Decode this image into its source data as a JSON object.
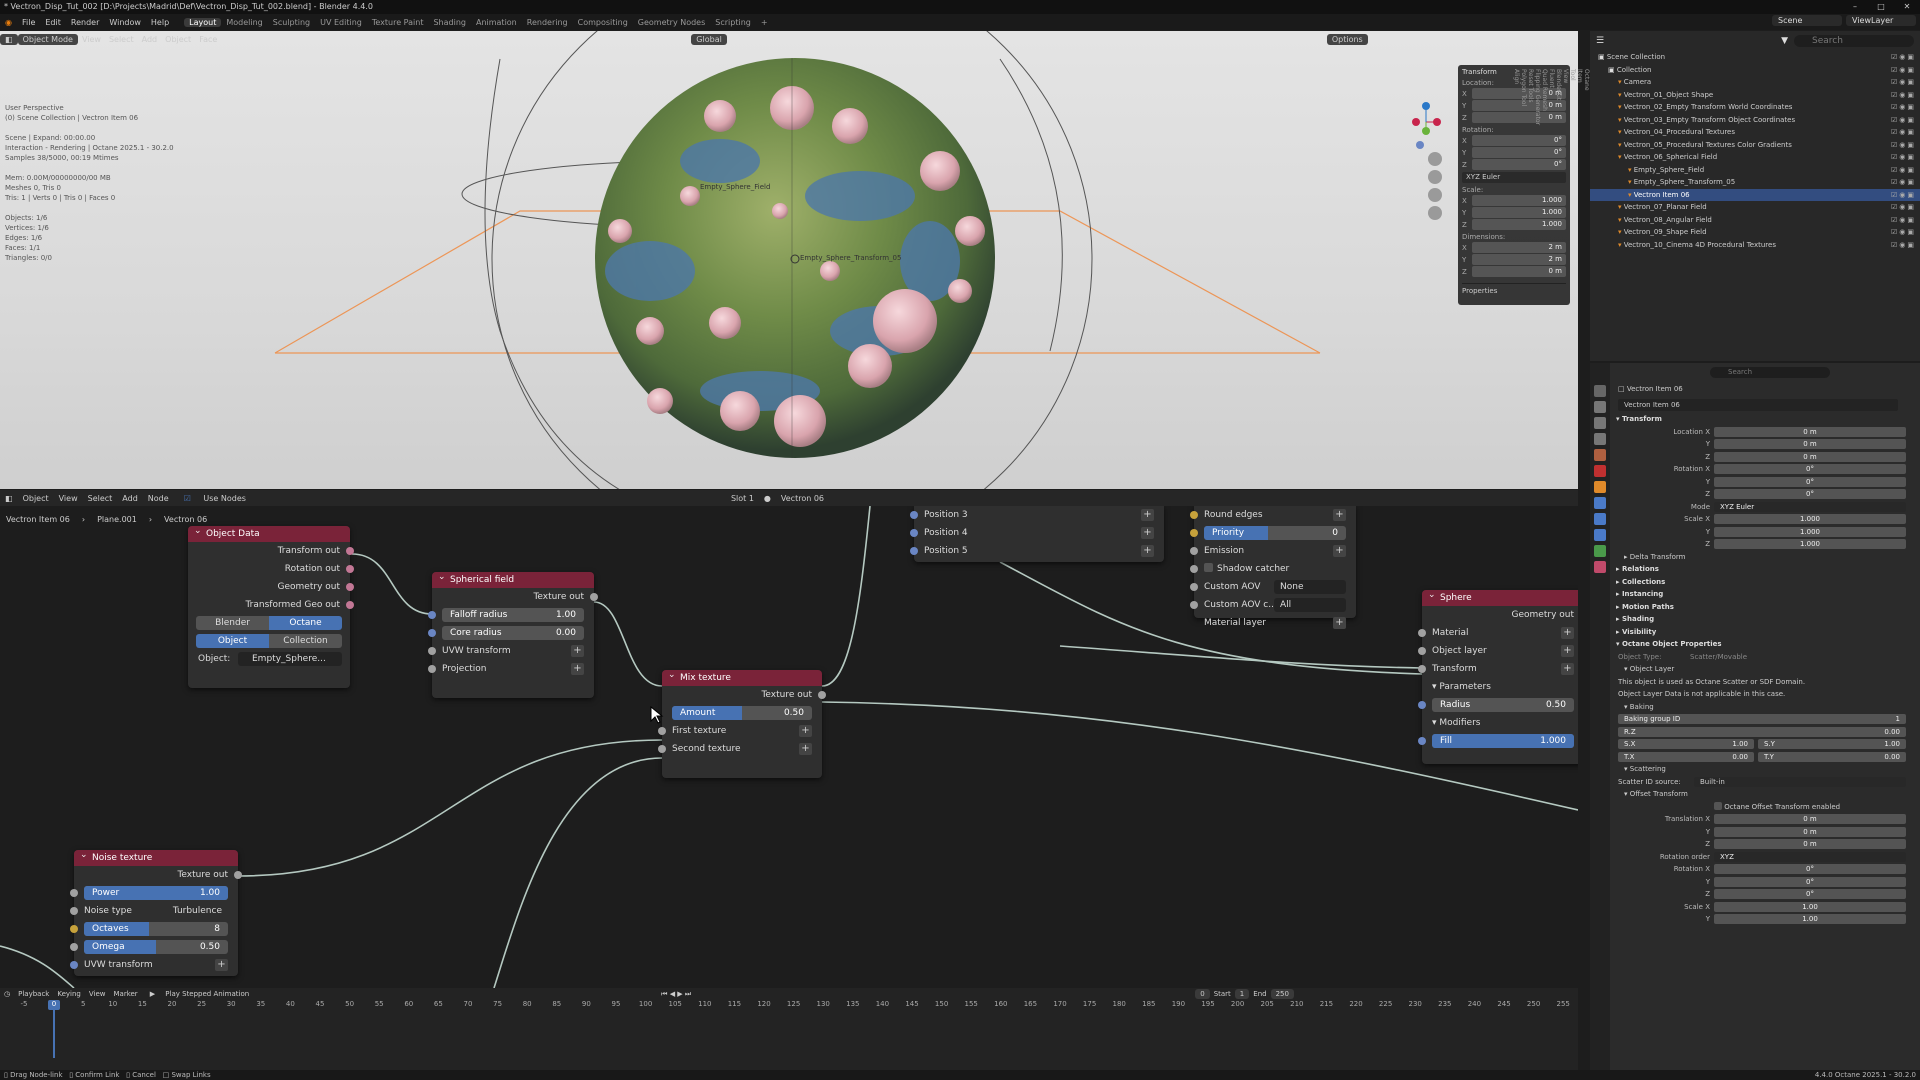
{
  "window": {
    "title": "* Vectron_Disp_Tut_002 [D:\\Projects\\Madrid\\Def\\Vectron_Disp_Tut_002.blend] - Blender 4.4.0"
  },
  "menubar": {
    "menus": [
      "File",
      "Edit",
      "Render",
      "Window",
      "Help"
    ],
    "workspaces": [
      "Layout",
      "Modeling",
      "Sculpting",
      "UV Editing",
      "Texture Paint",
      "Shading",
      "Animation",
      "Rendering",
      "Compositing",
      "Geometry Nodes",
      "Scripting"
    ],
    "active_workspace": "Layout",
    "scene": "Scene",
    "view_layer": "ViewLayer"
  },
  "viewport": {
    "mode": "Object Mode",
    "menus": [
      "View",
      "Select",
      "Add",
      "Object",
      "Face"
    ],
    "orientation": "Global",
    "options": "Options",
    "info": "User Perspective\n(0) Scene Collection | Vectron Item 06\n\nScene | Expand: 00:00.00\nInteraction - Rendering | Octane 2025.1 - 30.2.0\nSamples 38/5000, 00:19 Mtimes\n\nMem: 0.00M/00000000/00 MB\nMeshes 0, Tris 0\nTris: 1 | Verts 0 | Tris 0 | Faces 0\n\nObjects: 1/6\nVertices: 1/6\nEdges: 1/6\nFaces: 1/1\nTriangles: 0/0",
    "labels": {
      "field": "Empty_Sphere_Field",
      "transform": "Empty_Sphere_Transform_05"
    }
  },
  "n_panel": {
    "title": "Transform",
    "location_label": "Location:",
    "location": [
      {
        "axis": "X",
        "value": "0 m"
      },
      {
        "axis": "Y",
        "value": "0 m"
      },
      {
        "axis": "Z",
        "value": "0 m"
      }
    ],
    "rotation_label": "Rotation:",
    "rotation": [
      {
        "axis": "X",
        "value": "0°"
      },
      {
        "axis": "Y",
        "value": "0°"
      },
      {
        "axis": "Z",
        "value": "0°"
      }
    ],
    "rotation_mode": "XYZ Euler",
    "scale_label": "Scale:",
    "scale": [
      {
        "axis": "X",
        "value": "1.000"
      },
      {
        "axis": "Y",
        "value": "1.000"
      },
      {
        "axis": "Z",
        "value": "1.000"
      }
    ],
    "dimensions_label": "Dimensions:",
    "dimensions": [
      {
        "axis": "X",
        "value": "2 m"
      },
      {
        "axis": "Y",
        "value": "2 m"
      },
      {
        "axis": "Z",
        "value": "0 m"
      }
    ],
    "properties": "Properties",
    "tabs": [
      "Octane",
      "Item",
      "Tool",
      "View",
      "BlenderKit",
      "Fluent",
      "Quad Remesh",
      "Flipping Generator",
      "Reset Tools",
      "Polygon Tool",
      "Align"
    ]
  },
  "node_editor": {
    "header": {
      "type": "Object",
      "menus": [
        "View",
        "Select",
        "Add",
        "Node"
      ],
      "use_nodes": "Use Nodes",
      "slot": "Slot 1",
      "material": "Vectron 06"
    },
    "breadcrumb": [
      "Vectron Item 06",
      "Plane.001",
      "Vectron 06"
    ],
    "object_data": {
      "title": "Object Data",
      "outputs": [
        "Transform out",
        "Rotation out",
        "Geometry out",
        "Transformed Geo out"
      ],
      "toggle1": [
        "Blender",
        "Octane"
      ],
      "toggle2": [
        "Object",
        "Collection"
      ],
      "object_label": "Object:",
      "object_value": "Empty_Sphere..."
    },
    "spherical_field": {
      "title": "Spherical field",
      "output": "Texture out",
      "falloff": {
        "label": "Falloff radius",
        "value": "1.00"
      },
      "core": {
        "label": "Core radius",
        "value": "0.00"
      },
      "inputs": [
        "UVW transform",
        "Projection"
      ]
    },
    "mix_texture": {
      "title": "Mix texture",
      "output": "Texture out",
      "amount": {
        "label": "Amount",
        "value": "0.50",
        "fraction": 0.5
      },
      "inputs": [
        "First texture",
        "Second texture"
      ]
    },
    "noise_texture": {
      "title": "Noise texture",
      "output": "Texture out",
      "power": {
        "label": "Power",
        "value": "1.00",
        "fraction": 1.0
      },
      "noise_type": {
        "label": "Noise type",
        "value": "Turbulence"
      },
      "octaves": {
        "label": "Octaves",
        "value": "8",
        "fraction": 0.45
      },
      "omega": {
        "label": "Omega",
        "value": "0.50",
        "fraction": 0.5
      },
      "input": "UVW transform"
    },
    "positions": [
      "Position 3",
      "Position 4",
      "Position 5"
    ],
    "material_node": {
      "round_edges": "Round edges",
      "priority": {
        "label": "Priority",
        "value": "0"
      },
      "emission": "Emission",
      "shadow_catcher": "Shadow catcher",
      "custom_aov": {
        "label": "Custom AOV",
        "value": "None"
      },
      "custom_aov_c": {
        "label": "Custom AOV c...",
        "value": "All"
      },
      "material_layer": "Material layer"
    },
    "sphere": {
      "title": "Sphere",
      "output": "Geometry out",
      "inputs": [
        "Material",
        "Object layer",
        "Transform"
      ],
      "parameters": "Parameters",
      "radius": {
        "label": "Radius",
        "value": "0.50"
      },
      "modifiers": "Modifiers",
      "fill": {
        "label": "Fill",
        "value": "1.000",
        "fraction": 1.0
      }
    }
  },
  "timeline": {
    "menus": [
      "Playback",
      "Keying",
      "View",
      "Marker"
    ],
    "play_stepped": "Play Stepped Animation",
    "current_frame": "0",
    "start_label": "Start",
    "start": "1",
    "end_label": "End",
    "end": "250",
    "ticks": [
      "-5",
      "0",
      "5",
      "10",
      "15",
      "20",
      "25",
      "30",
      "35",
      "40",
      "45",
      "50",
      "55",
      "60",
      "65",
      "70",
      "75",
      "80",
      "85",
      "90",
      "95",
      "100",
      "105",
      "110",
      "115",
      "120",
      "125",
      "130",
      "135",
      "140",
      "145",
      "150",
      "155",
      "160",
      "165",
      "170",
      "175",
      "180",
      "185",
      "190",
      "195",
      "200",
      "205",
      "210",
      "215",
      "220",
      "225",
      "230",
      "235",
      "240",
      "245",
      "250",
      "255"
    ]
  },
  "statusbar": {
    "items": [
      "Drag Node-link",
      "Confirm Link",
      "Cancel",
      "Swap Links"
    ],
    "version": "4.4.0    Octane 2025.1 - 30.2.0"
  },
  "outliner": {
    "search_placeholder": "Search",
    "rows": [
      {
        "label": "Scene Collection",
        "indent": 0,
        "sel": false
      },
      {
        "label": "Collection",
        "indent": 1,
        "sel": false
      },
      {
        "label": "Camera",
        "indent": 2,
        "sel": false
      },
      {
        "label": "Vectron_01_Object Shape",
        "indent": 2,
        "sel": false
      },
      {
        "label": "Vectron_02_Empty Transform World Coordinates",
        "indent": 2,
        "sel": false
      },
      {
        "label": "Vectron_03_Empty Transform Object Coordinates",
        "indent": 2,
        "sel": false
      },
      {
        "label": "Vectron_04_Procedural Textures",
        "indent": 2,
        "sel": false
      },
      {
        "label": "Vectron_05_Procedural Textures Color Gradients",
        "indent": 2,
        "sel": false
      },
      {
        "label": "Vectron_06_Spherical Field",
        "indent": 2,
        "sel": false
      },
      {
        "label": "Empty_Sphere_Field",
        "indent": 3,
        "sel": false
      },
      {
        "label": "Empty_Sphere_Transform_05",
        "indent": 3,
        "sel": false
      },
      {
        "label": "Vectron Item 06",
        "indent": 3,
        "sel": true
      },
      {
        "label": "Vectron_07_Planar Field",
        "indent": 2,
        "sel": false
      },
      {
        "label": "Vectron_08_Angular Field",
        "indent": 2,
        "sel": false
      },
      {
        "label": "Vectron_09_Shape Field",
        "indent": 2,
        "sel": false
      },
      {
        "label": "Vectron_10_Cinema 4D Procedural Textures",
        "indent": 2,
        "sel": false
      }
    ]
  },
  "properties": {
    "search_placeholder": "Search",
    "object_name": "Vectron Item 06",
    "object_sub": "Vectron Item 06",
    "transform": "Transform",
    "location_x": {
      "label": "Location X",
      "value": "0 m"
    },
    "location_y": {
      "label": "Y",
      "value": "0 m"
    },
    "location_z": {
      "label": "Z",
      "value": "0 m"
    },
    "rotation_x": {
      "label": "Rotation X",
      "value": "0°"
    },
    "rotation_y": {
      "label": "Y",
      "value": "0°"
    },
    "rotation_z": {
      "label": "Z",
      "value": "0°"
    },
    "mode": {
      "label": "Mode",
      "value": "XYZ Euler"
    },
    "scale_x": {
      "label": "Scale X",
      "value": "1.000"
    },
    "scale_y": {
      "label": "Y",
      "value": "1.000"
    },
    "scale_z": {
      "label": "Z",
      "value": "1.000"
    },
    "sections": [
      "Delta Transform",
      "Relations",
      "Collections",
      "Instancing",
      "Motion Paths",
      "Shading",
      "Visibility"
    ],
    "octane_props": "Octane Object Properties",
    "object_type": {
      "label": "Object Type:",
      "value": "Scatter/Movable"
    },
    "object_layer": "Object Layer",
    "note1": "This object is used as Octane Scatter or SDF Domain.",
    "note2": "Object Layer Data is not applicable in this case.",
    "baking": "Baking",
    "baking_group": {
      "label": "Baking group ID",
      "value": "1"
    },
    "rz": {
      "label": "R.Z",
      "value": "0.00"
    },
    "sx": {
      "label": "S.X",
      "value": "1.00"
    },
    "sy": {
      "label": "S.Y",
      "value": "1.00"
    },
    "tx": {
      "label": "T.X",
      "value": "0.00"
    },
    "ty": {
      "label": "T.Y",
      "value": "0.00"
    },
    "scattering": "Scattering",
    "scatter_id": {
      "label": "Scatter ID source:",
      "value": "Built-in"
    },
    "offset_transform": "Offset Transform",
    "offset_enabled": "Octane Offset Transform enabled",
    "translation_x": {
      "label": "Translation X",
      "value": "0 m"
    },
    "translation_y": {
      "label": "Y",
      "value": "0 m"
    },
    "translation_z": {
      "label": "Z",
      "value": "0 m"
    },
    "rotation_order": {
      "label": "Rotation order",
      "value": "XYZ"
    },
    "orot_x": {
      "label": "Rotation X",
      "value": "0°"
    },
    "orot_y": {
      "label": "Y",
      "value": "0°"
    },
    "orot_z": {
      "label": "Z",
      "value": "0°"
    },
    "oscale_x": {
      "label": "Scale X",
      "value": "1.00"
    },
    "oscale_y": {
      "label": "Y",
      "value": "1.00"
    }
  },
  "colors": {
    "accent": "#4772b3",
    "node_header": "#7a2339",
    "selection": "#334d80"
  }
}
